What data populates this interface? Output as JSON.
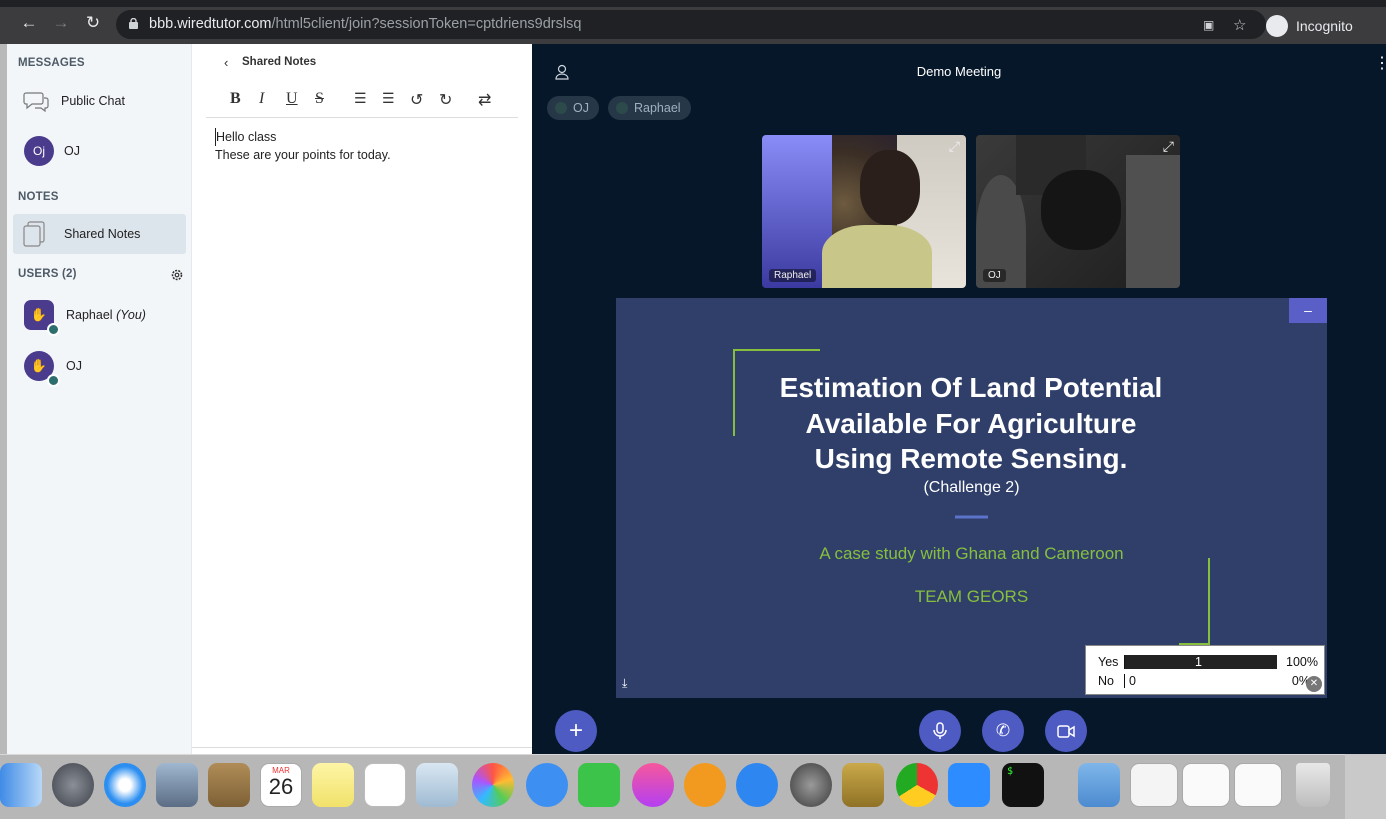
{
  "browser": {
    "url_host": "bbb.wiredtutor.com",
    "url_path": "/html5client/join?sessionToken=cptdriens9drslsq",
    "incognito_label": "Incognito"
  },
  "sidebar": {
    "messages_heading": "MESSAGES",
    "public_chat": "Public Chat",
    "chat_user_initials": "Oj",
    "chat_user_name": "OJ",
    "notes_heading": "NOTES",
    "shared_notes": "Shared Notes",
    "users_heading": "USERS (2)",
    "users": [
      {
        "name": "Raphael",
        "suffix": "(You)"
      },
      {
        "name": "OJ",
        "suffix": ""
      }
    ]
  },
  "notes_panel": {
    "title": "Shared Notes",
    "toolbar": [
      "B",
      "I",
      "U",
      "S"
    ],
    "lines": [
      "Hello class",
      "These are your points for today."
    ]
  },
  "meeting": {
    "title": "Demo Meeting",
    "talkers": [
      "OJ",
      "Raphael"
    ],
    "videos": [
      {
        "label": "Raphael"
      },
      {
        "label": "OJ"
      }
    ],
    "slide": {
      "title_lines": [
        "Estimation Of Land Potential",
        "Available For Agriculture",
        "Using Remote Sensing."
      ],
      "subtitle": "(Challenge 2)",
      "case_study": "A case study with Ghana and Cameroon",
      "team": "TEAM GEORS"
    },
    "poll": {
      "rows": [
        {
          "label": "Yes",
          "count": "1",
          "percent": "100%",
          "fill": 1.0
        },
        {
          "label": "No",
          "count": "0",
          "percent": "0%",
          "fill": 0.0
        }
      ]
    },
    "minimize_label": "–"
  },
  "dock": {
    "calendar_month": "MAR",
    "calendar_day": "26"
  }
}
